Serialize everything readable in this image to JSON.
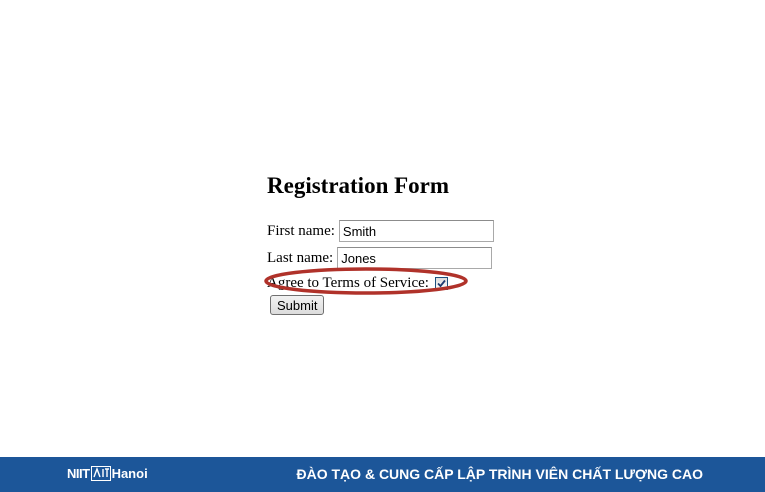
{
  "form": {
    "title": "Registration Form",
    "first_name": {
      "label": "First name:",
      "value": "Smith"
    },
    "last_name": {
      "label": "Last name:",
      "value": "Jones"
    },
    "terms": {
      "label": "Agree to Terms of Service:",
      "checked": true
    },
    "submit_label": "Submit"
  },
  "annotation": {
    "color": "#b0322a"
  },
  "footer": {
    "background": "#1c5699",
    "logo_text": "NIIT",
    "logo_box_text": "ICT",
    "logo_city": "Hanoi",
    "tagline": "ĐÀO TẠO & CUNG CẤP LẬP TRÌNH VIÊN CHẤT LƯỢNG CAO"
  }
}
